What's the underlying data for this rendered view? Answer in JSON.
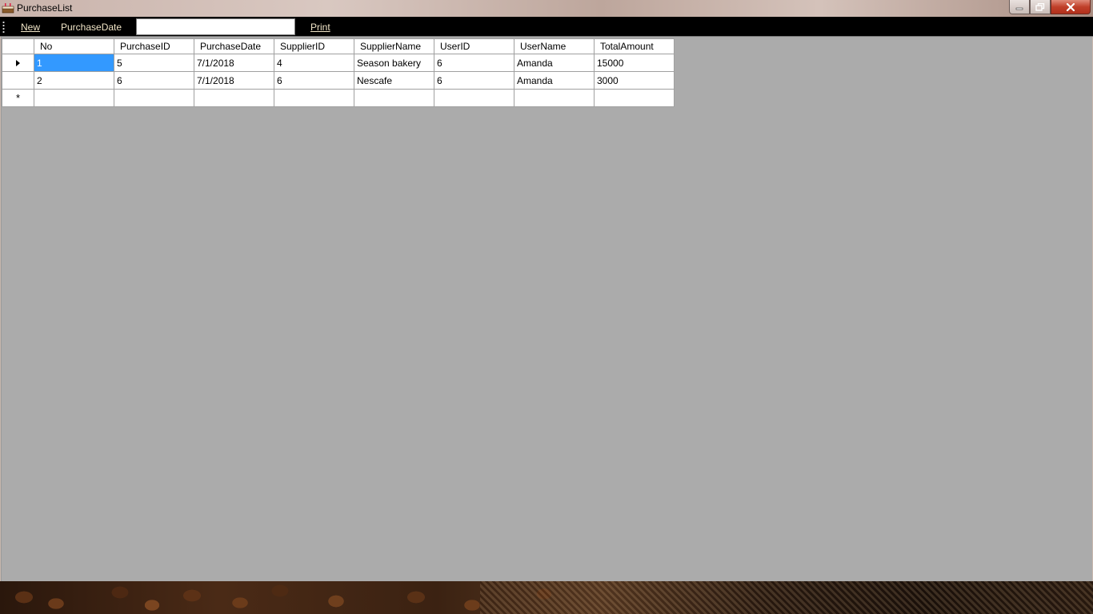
{
  "window": {
    "title": "PurchaseList"
  },
  "menu": {
    "new_label": "New",
    "purchase_date_label": "PurchaseDate",
    "purchase_date_value": "",
    "print_label": "Print"
  },
  "grid": {
    "columns": [
      "No",
      "PurchaseID",
      "PurchaseDate",
      "SupplierID",
      "SupplierName",
      "UserID",
      "UserName",
      "TotalAmount"
    ],
    "rows": [
      [
        "1",
        "5",
        "7/1/2018",
        "4",
        "Season bakery",
        "6",
        "Amanda",
        "15000"
      ],
      [
        "2",
        "6",
        "7/1/2018",
        "6",
        "Nescafe",
        "6",
        "Amanda",
        "3000"
      ]
    ],
    "current_row_indicator": "arrow",
    "new_row_indicator": "*",
    "selected_cell": {
      "row": 0,
      "col": 0
    }
  },
  "colors": {
    "grid_background": "#ababab",
    "menu_background": "#000000",
    "menu_text": "#f2e6c8",
    "selection": "#3399ff",
    "close_button": "#c0402a"
  }
}
